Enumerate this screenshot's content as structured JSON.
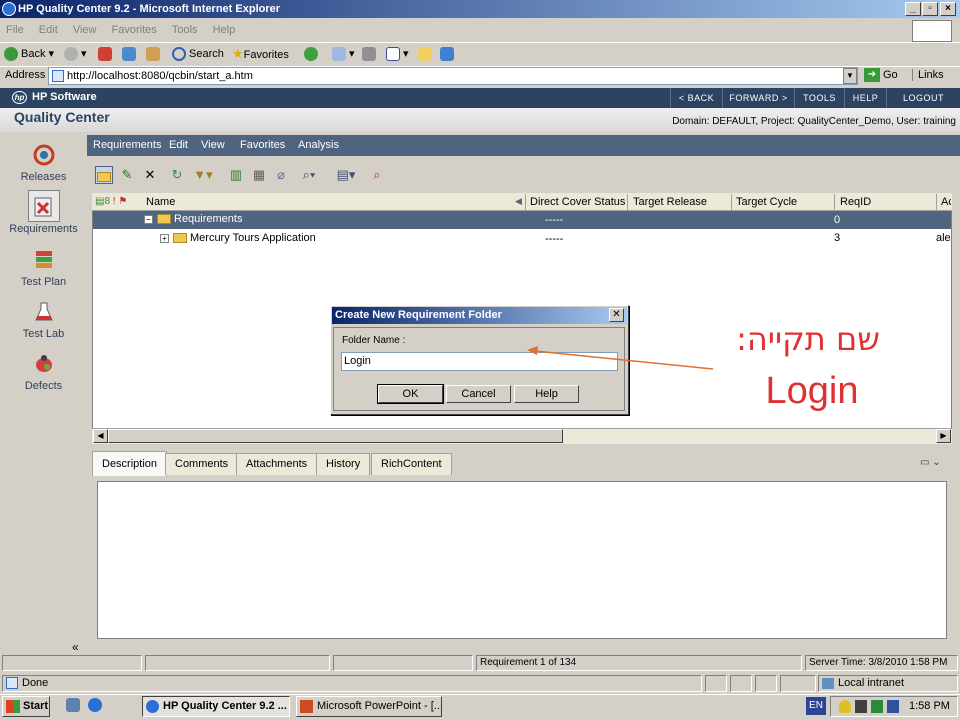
{
  "window": {
    "title": "HP Quality Center 9.2 - Microsoft Internet Explorer"
  },
  "ie_menu": [
    "File",
    "Edit",
    "View",
    "Favorites",
    "Tools",
    "Help"
  ],
  "ie_toolbar": {
    "back": "Back",
    "search": "Search",
    "favorites": "Favorites"
  },
  "address": {
    "label": "Address",
    "url": "http://localhost:8080/qcbin/start_a.htm",
    "go": "Go",
    "links": "Links"
  },
  "qc_header": {
    "brand": "HP Software",
    "product": "Quality Center",
    "nav": [
      "< BACK",
      "FORWARD >",
      "TOOLS",
      "HELP",
      "LOGOUT"
    ],
    "domain_info": "Domain: DEFAULT, Project: QualityCenter_Demo, User: training"
  },
  "sidebar": [
    {
      "label": "Releases",
      "icon": "releases-icon"
    },
    {
      "label": "Requirements",
      "icon": "requirements-icon"
    },
    {
      "label": "Test Plan",
      "icon": "test-plan-icon"
    },
    {
      "label": "Test Lab",
      "icon": "test-lab-icon"
    },
    {
      "label": "Defects",
      "icon": "defects-icon"
    }
  ],
  "module_menu": [
    "Requirements",
    "Edit",
    "View",
    "Favorites",
    "Analysis"
  ],
  "grid": {
    "columns": [
      "Name",
      "Direct Cover Status",
      "Target Release",
      "Target Cycle",
      "ReqID",
      "Ac"
    ],
    "rows": [
      {
        "name": "Requirements",
        "cover": "-----",
        "reqid": "0",
        "author": ""
      },
      {
        "name": "Mercury Tours Application",
        "cover": "-----",
        "reqid": "3",
        "author": "alex"
      }
    ]
  },
  "tabs": [
    "Description",
    "Comments",
    "Attachments",
    "History",
    "RichContent"
  ],
  "qc_status": {
    "record": "Requirement 1 of 134",
    "server_time": "Server Time: 3/8/2010 1:58 PM"
  },
  "ie_status": {
    "done": "Done",
    "zone": "Local intranet"
  },
  "dialog": {
    "title": "Create New Requirement Folder",
    "field_label": "Folder Name :",
    "field_value": "Login",
    "ok": "OK",
    "cancel": "Cancel",
    "help": "Help"
  },
  "annotation": {
    "hebrew": "שם תקייה:",
    "value": "Login",
    "color": "#e03030"
  },
  "taskbar": {
    "start": "Start",
    "tasks": [
      "HP Quality Center 9.2 ...",
      "Microsoft PowerPoint - [..."
    ],
    "lang": "EN",
    "clock": "1:58 PM"
  }
}
